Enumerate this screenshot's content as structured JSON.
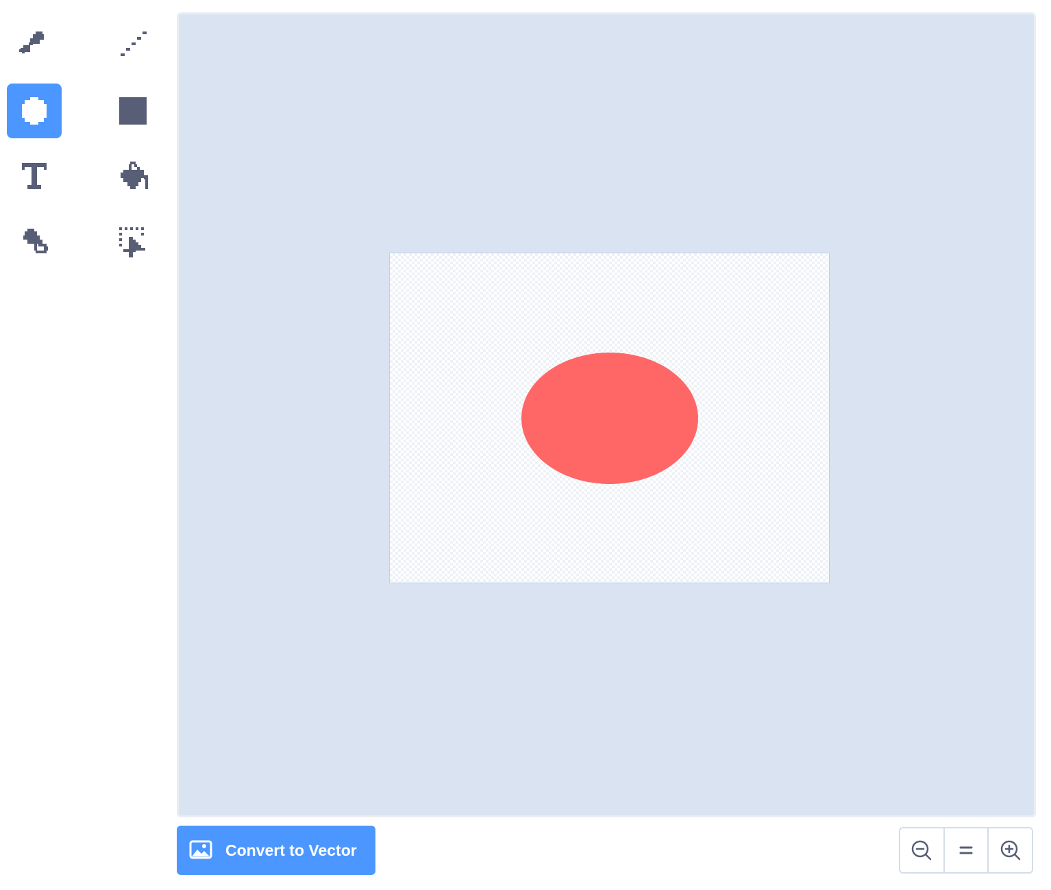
{
  "toolbar": {
    "tools": [
      {
        "name": "brush",
        "icon": "brush-icon",
        "selected": false
      },
      {
        "name": "line",
        "icon": "line-icon",
        "selected": false
      },
      {
        "name": "circle",
        "icon": "circle-icon",
        "selected": true
      },
      {
        "name": "rectangle",
        "icon": "rectangle-icon",
        "selected": false
      },
      {
        "name": "text",
        "icon": "text-icon",
        "selected": false
      },
      {
        "name": "fill",
        "icon": "fill-bucket-icon",
        "selected": false
      },
      {
        "name": "eraser",
        "icon": "eraser-icon",
        "selected": false
      },
      {
        "name": "select",
        "icon": "select-icon",
        "selected": false
      }
    ],
    "text_tool_glyph": "T"
  },
  "canvas": {
    "shape": {
      "type": "ellipse",
      "fill_color": "#ff6666"
    }
  },
  "footer": {
    "convert_label": "Convert to Vector",
    "convert_icon": "image-icon",
    "zoom": {
      "zoom_out_icon": "zoom-out-icon",
      "zoom_reset_icon": "zoom-reset-icon",
      "zoom_in_icon": "zoom-in-icon"
    }
  },
  "colors": {
    "accent": "#4c97ff",
    "icon": "#575e75",
    "canvas_bg": "#d9e3f2",
    "shape": "#ff6666"
  }
}
